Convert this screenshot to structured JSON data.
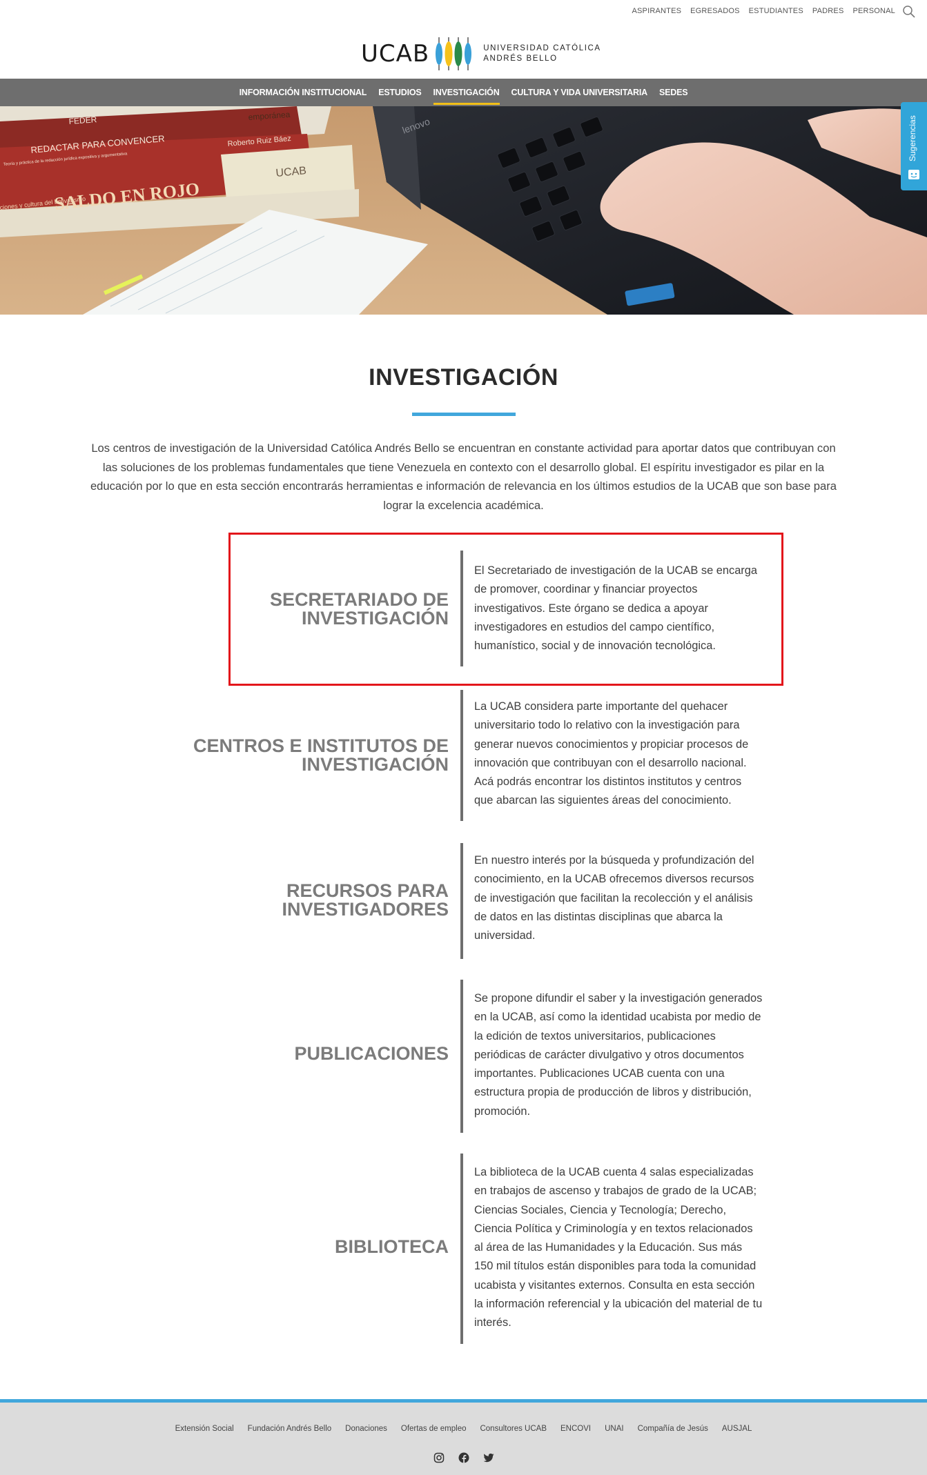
{
  "top_links": [
    "ASPIRANTES",
    "EGRESADOS",
    "ESTUDIANTES",
    "PADRES",
    "PERSONAL"
  ],
  "logo": {
    "wordmark": "UCAB",
    "line1": "UNIVERSIDAD CATÓLICA",
    "line2": "ANDRÉS BELLO"
  },
  "nav": [
    {
      "label": "INFORMACIÓN INSTITUCIONAL",
      "active": false
    },
    {
      "label": "ESTUDIOS",
      "active": false
    },
    {
      "label": "INVESTIGACIÓN",
      "active": true
    },
    {
      "label": "CULTURA Y VIDA UNIVERSITARIA",
      "active": false
    },
    {
      "label": "SEDES",
      "active": false
    }
  ],
  "side_tab": {
    "label": "Sugerencias"
  },
  "hero": {
    "book_texts": [
      "FEDER",
      "emporánea",
      "REDACTAR PARA CONVENCER",
      "Roberto Ruiz Báez",
      "Teoría y práctica de la redacción jurídica expositiva y argumentativa",
      "SALDO EN ROJO",
      "ciones y cultura del bolivarismo",
      "UCAB"
    ],
    "laptop_brand": "lenovo"
  },
  "page": {
    "title": "INVESTIGACIÓN",
    "intro": "Los centros de investigación de la Universidad Católica Andrés Bello se encuentran en constante actividad para aportar datos que contribuyan con las soluciones de los problemas fundamentales que tiene Venezuela en contexto con el desarrollo global. El espíritu investigador es pilar en la educación por lo que en esta sección encontrarás herramientas e información de relevancia en los últimos estudios de la UCAB que son base para lograr la excelencia académica."
  },
  "sections": [
    {
      "title_lines": [
        "SECRETARIADO DE",
        "INVESTIGACIÓN"
      ],
      "text": "El Secretariado de investigación de la UCAB se encarga de promover, coordinar y financiar proyectos investigativos. Este órgano se dedica a apoyar investigadores en estudios del campo científico, humanístico, social y de innovación tecnológica."
    },
    {
      "title_lines": [
        "CENTROS E INSTITUTOS DE",
        "INVESTIGACIÓN"
      ],
      "text": "La UCAB considera parte importante del quehacer universitario todo lo relativo con la investigación para generar nuevos conocimientos y propiciar procesos de innovación que contribuyan con el desarrollo nacional. Acá podrás encontrar los distintos institutos y centros que abarcan las siguientes áreas del conocimiento."
    },
    {
      "title_lines": [
        "RECURSOS PARA",
        "INVESTIGADORES"
      ],
      "text": "En nuestro interés por la búsqueda y profundización del conocimiento, en la UCAB ofrecemos diversos recursos de investigación que facilitan la recolección y el análisis de datos en las distintas disciplinas que abarca la universidad."
    },
    {
      "title_lines": [
        "PUBLICACIONES"
      ],
      "text": "Se propone difundir el saber y la investigación generados en la UCAB, así como la identidad ucabista por medio de la edición de textos universitarios, publicaciones periódicas de carácter divulgativo y otros documentos importantes. Publicaciones UCAB cuenta con una estructura propia de producción de libros y distribución, promoción."
    },
    {
      "title_lines": [
        "BIBLIOTECA"
      ],
      "text": "La biblioteca de la UCAB cuenta 4 salas especializadas en trabajos de ascenso y trabajos de grado de la UCAB; Ciencias Sociales, Ciencia y Tecnología; Derecho, Ciencia Política y Criminología y en textos relacionados al área de las Humanidades y la Educación. Sus más 150 mil títulos están disponibles para toda la comunidad ucabista y visitantes externos. Consulta en esta sección la información referencial y la ubicación del material de tu interés."
    }
  ],
  "footer": {
    "links": [
      "Extensión Social",
      "Fundación Andrés Bello",
      "Donaciones",
      "Ofertas de empleo",
      "Consultores UCAB",
      "ENCOVI",
      "UNAI",
      "Compañía de Jesús",
      "AUSJAL"
    ],
    "social_icons": [
      "instagram-icon",
      "facebook-icon",
      "twitter-icon"
    ]
  },
  "colors": {
    "nav_bg": "#6e6e6e",
    "accent_blue": "#41a7dc",
    "nav_active_underline": "#f2c018",
    "highlight_red": "#e3161b",
    "footer_bg": "#dcdcdc"
  }
}
